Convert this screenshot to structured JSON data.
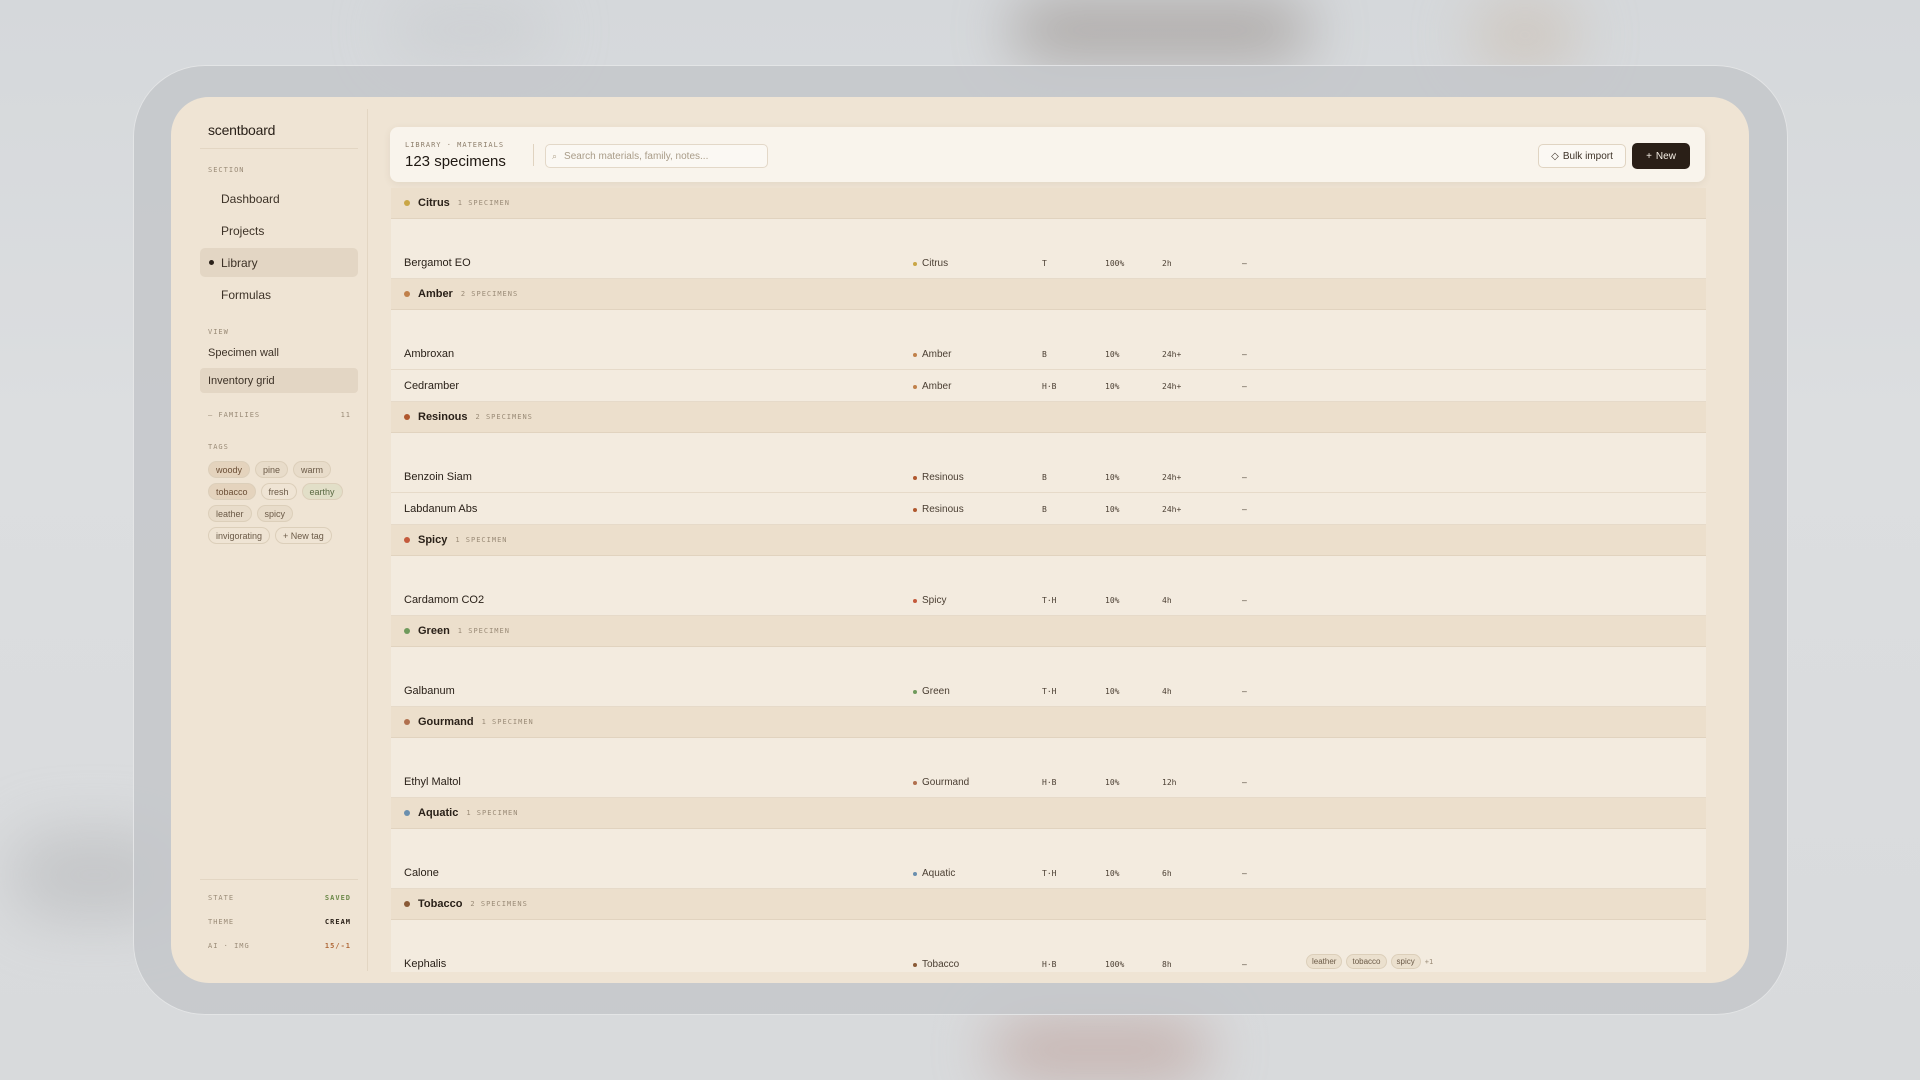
{
  "brand": "scentboard",
  "sidebar": {
    "section_label": "SECTION",
    "nav": [
      {
        "label": "Dashboard",
        "active": false
      },
      {
        "label": "Projects",
        "active": false
      },
      {
        "label": "Library",
        "active": true
      },
      {
        "label": "Formulas",
        "active": false
      }
    ],
    "view_label": "VIEW",
    "views": [
      {
        "label": "Specimen wall",
        "active": false
      },
      {
        "label": "Inventory grid",
        "active": true
      }
    ],
    "families_label": "– FAMILIES",
    "families_count": "11",
    "tags_label": "TAGS",
    "tags": [
      "woody",
      "pine",
      "warm",
      "tobacco",
      "fresh",
      "earthy",
      "leather",
      "spicy",
      "invigorating"
    ],
    "new_tag": "+ New tag",
    "footer": [
      {
        "key": "STATE",
        "value": "SAVED",
        "color": "#6d8a4a"
      },
      {
        "key": "THEME",
        "value": "CREAM",
        "color": "#2a2119"
      },
      {
        "key": "AI · IMG",
        "value": "15/-1",
        "color": "#b06a3a"
      }
    ]
  },
  "header": {
    "breadcrumb": "LIBRARY · MATERIALS",
    "title": "123 specimens",
    "search_placeholder": "Search materials, family, notes...",
    "search_icon": "⌕",
    "bulk_import": "Bulk import",
    "bulk_icon": "◇",
    "new_label": "New",
    "new_icon": "+"
  },
  "groups": [
    {
      "name": "Citrus",
      "count": "1 SPECIMEN",
      "color": "#c9a646",
      "rows": [
        {
          "name": "Bergamot EO",
          "family": "Citrus",
          "note": "T",
          "dilution": "100%",
          "longevity": "2h",
          "dash": "–",
          "tags": []
        }
      ]
    },
    {
      "name": "Amber",
      "count": "2 SPECIMENS",
      "color": "#c0804a",
      "rows": [
        {
          "name": "Ambroxan",
          "family": "Amber",
          "note": "B",
          "dilution": "10%",
          "longevity": "24h+",
          "dash": "–",
          "tags": []
        },
        {
          "name": "Cedramber",
          "family": "Amber",
          "note": "H·B",
          "dilution": "10%",
          "longevity": "24h+",
          "dash": "–",
          "tags": []
        }
      ]
    },
    {
      "name": "Resinous",
      "count": "2 SPECIMENS",
      "color": "#b0582e",
      "rows": [
        {
          "name": "Benzoin Siam",
          "family": "Resinous",
          "note": "B",
          "dilution": "10%",
          "longevity": "24h+",
          "dash": "–",
          "tags": []
        },
        {
          "name": "Labdanum Abs",
          "family": "Resinous",
          "note": "B",
          "dilution": "10%",
          "longevity": "24h+",
          "dash": "–",
          "tags": []
        }
      ]
    },
    {
      "name": "Spicy",
      "count": "1 SPECIMEN",
      "color": "#c45a3c",
      "rows": [
        {
          "name": "Cardamom CO2",
          "family": "Spicy",
          "note": "T·H",
          "dilution": "10%",
          "longevity": "4h",
          "dash": "–",
          "tags": []
        }
      ]
    },
    {
      "name": "Green",
      "count": "1 SPECIMEN",
      "color": "#6f9a5c",
      "rows": [
        {
          "name": "Galbanum",
          "family": "Green",
          "note": "T·H",
          "dilution": "10%",
          "longevity": "4h",
          "dash": "–",
          "tags": []
        }
      ]
    },
    {
      "name": "Gourmand",
      "count": "1 SPECIMEN",
      "color": "#b0704e",
      "rows": [
        {
          "name": "Ethyl Maltol",
          "family": "Gourmand",
          "note": "H·B",
          "dilution": "10%",
          "longevity": "12h",
          "dash": "–",
          "tags": []
        }
      ]
    },
    {
      "name": "Aquatic",
      "count": "1 SPECIMEN",
      "color": "#6a8fae",
      "rows": [
        {
          "name": "Calone",
          "family": "Aquatic",
          "note": "T·H",
          "dilution": "10%",
          "longevity": "6h",
          "dash": "–",
          "tags": []
        }
      ]
    },
    {
      "name": "Tobacco",
      "count": "2 SPECIMENS",
      "color": "#8a5a36",
      "rows": [
        {
          "name": "Kephalis",
          "family": "Tobacco",
          "note": "H·B",
          "dilution": "100%",
          "longevity": "8h",
          "dash": "–",
          "tags": [
            "leather",
            "tobacco",
            "spicy"
          ],
          "more": "+1"
        }
      ]
    }
  ]
}
